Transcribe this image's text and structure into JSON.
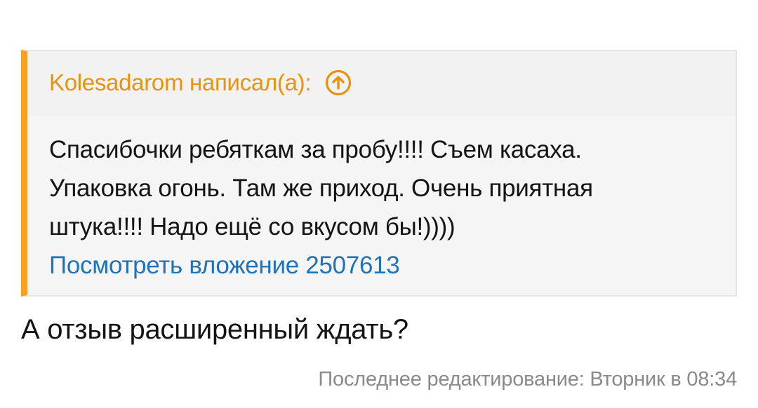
{
  "quote": {
    "author_label": "Kolesadarom написал(а):",
    "jump_icon": "arrow-up-circle-icon",
    "text": "Спасибочки ребяткам за пробу!!!! Съем касаха. Упаковка огонь. Там же приход. Очень приятная штука!!!! Надо ещё со вкусом бы!))))",
    "attachment_link": "Посмотреть вложение 2507613",
    "accent_color": "#f7a120"
  },
  "reply": {
    "text": "А отзыв расширенный ждать?"
  },
  "footer": {
    "last_edit": "Последнее редактирование: Вторник в 08:34"
  }
}
